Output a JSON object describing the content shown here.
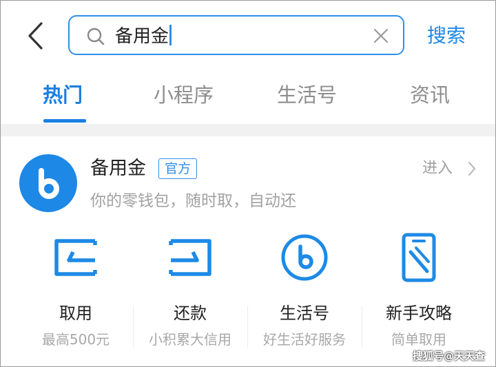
{
  "header": {
    "search": {
      "query": "备用金"
    },
    "search_button": "搜索"
  },
  "tabs": [
    {
      "label": "热门",
      "active": true
    },
    {
      "label": "小程序",
      "active": false
    },
    {
      "label": "生活号",
      "active": false
    },
    {
      "label": "资讯",
      "active": false
    }
  ],
  "service": {
    "name": "备用金",
    "badge": "官方",
    "description": "你的零钱包，随时取，自动还",
    "enter_label": "进入",
    "logo_icon": "b-logo-icon",
    "brand_color": "#1d88e5"
  },
  "actions": [
    {
      "label": "取用",
      "sub": "最高500元",
      "icon": "withdraw-icon"
    },
    {
      "label": "还款",
      "sub": "小积累大信用",
      "icon": "repay-icon"
    },
    {
      "label": "生活号",
      "sub": "好生活好服务",
      "icon": "life-account-icon"
    },
    {
      "label": "新手攻略",
      "sub": "简单取用",
      "icon": "guide-icon"
    }
  ],
  "watermark": "搜狐号@天天查",
  "colors": {
    "accent": "#1a7fe2",
    "muted_text": "#a2a2a2"
  }
}
